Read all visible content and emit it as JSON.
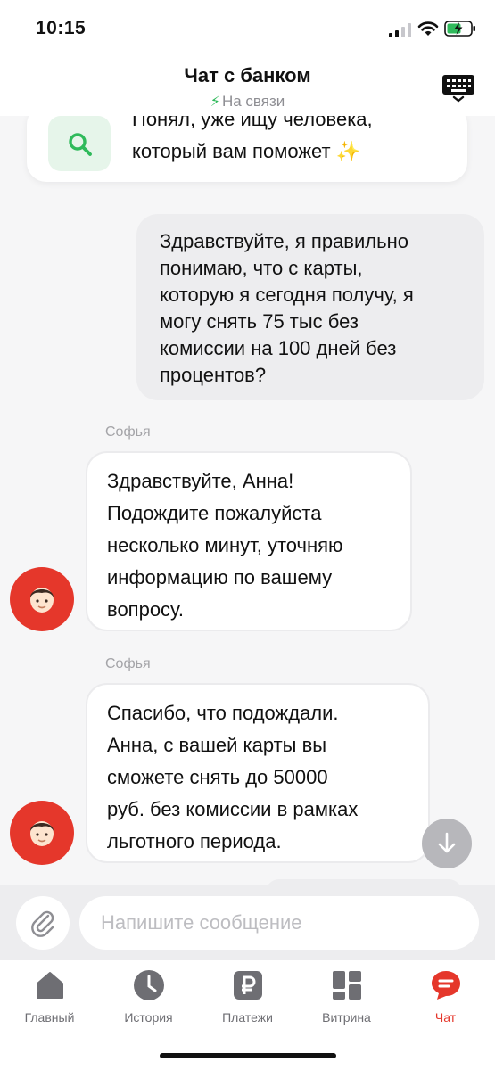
{
  "status_bar": {
    "time": "10:15"
  },
  "header": {
    "title": "Чат с банком",
    "status": "На связи",
    "bolt_icon": "bolt-icon",
    "keyboard_icon": "keyboard-icon"
  },
  "system_message": {
    "line1": "Понял, уже ищу человека,",
    "line2": "который вам поможет",
    "emoji": "✨",
    "icon": "search-icon"
  },
  "messages": [
    {
      "type": "outgoing",
      "lines": [
        "Здравствуйте, я правильно",
        "понимаю, что с карты,",
        "которую я сегодня получу, я",
        "могу снять 75 тыс без",
        "комиссии на 100 дней без",
        "процентов?"
      ]
    },
    {
      "type": "incoming",
      "sender": "Софья",
      "lines": [
        "Здравствуйте, Анна!",
        "Подождите пожалуйста",
        "несколько минут, уточняю",
        "информацию по вашему",
        "вопросу."
      ]
    },
    {
      "type": "incoming",
      "sender": "Софья",
      "lines": [
        "Спасибо, что подождали.",
        "Анна, с вашей карты вы",
        "сможете снять до 50000",
        "руб. без комиссии в рамках",
        "льготного периода."
      ]
    }
  ],
  "composer": {
    "placeholder": "Напишите сообщение",
    "attach_icon": "paperclip-icon"
  },
  "tabs": [
    {
      "label": "Главный",
      "icon": "home-icon"
    },
    {
      "label": "История",
      "icon": "clock-icon"
    },
    {
      "label": "Платежи",
      "icon": "ruble-icon"
    },
    {
      "label": "Витрина",
      "icon": "showcase-icon"
    },
    {
      "label": "Чат",
      "icon": "chat-icon",
      "active": true
    }
  ],
  "colors": {
    "accent": "#E5372B",
    "online": "#2FBA5B",
    "tab_inactive": "#6E6E73"
  }
}
